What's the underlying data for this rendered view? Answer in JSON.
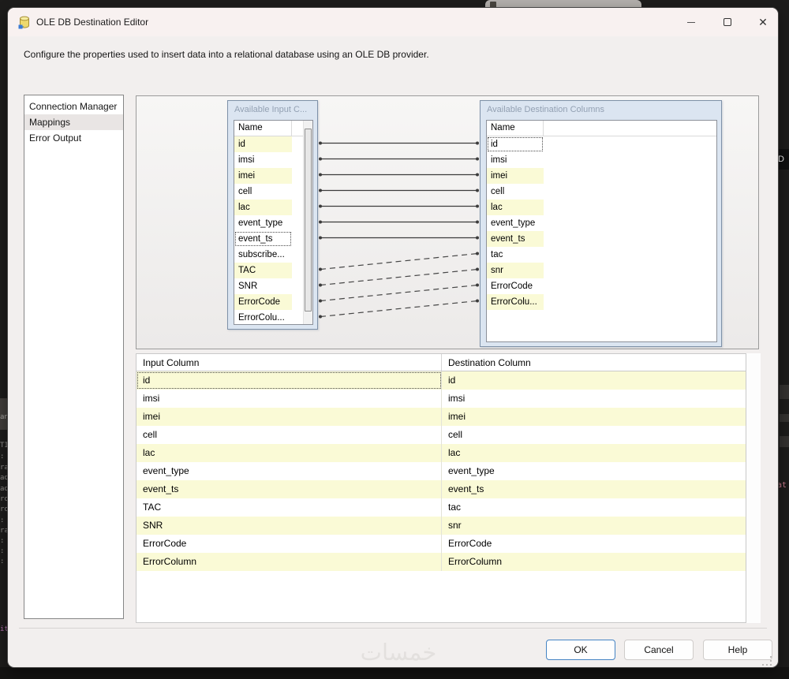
{
  "window": {
    "title": "OLE DB Destination Editor",
    "description": "Configure the properties used to insert data into a relational database using an OLE DB provider.",
    "controls": {
      "minimize": "minimize",
      "maximize": "maximize",
      "close": "close"
    }
  },
  "sidebar": {
    "items": [
      {
        "label": "Connection Manager",
        "selected": false
      },
      {
        "label": "Mappings",
        "selected": true
      },
      {
        "label": "Error Output",
        "selected": false
      }
    ]
  },
  "diagram": {
    "input_panel": {
      "title": "Available Input C...",
      "column_header": "Name",
      "rows": [
        "id",
        "imsi",
        "imei",
        "cell",
        "lac",
        "event_type",
        "event_ts",
        "subscribe...",
        "TAC",
        "SNR",
        "ErrorCode",
        "ErrorColu..."
      ],
      "focused_row": "event_ts"
    },
    "destination_panel": {
      "title": "Available Destination Columns",
      "column_header": "Name",
      "rows": [
        "id",
        "imsi",
        "imei",
        "cell",
        "lac",
        "event_type",
        "event_ts",
        "tac",
        "snr",
        "ErrorCode",
        "ErrorColu..."
      ],
      "focused_row": "id"
    },
    "connections": [
      {
        "from_index": 0,
        "to_index": 0,
        "style": "solid"
      },
      {
        "from_index": 1,
        "to_index": 1,
        "style": "solid"
      },
      {
        "from_index": 2,
        "to_index": 2,
        "style": "solid"
      },
      {
        "from_index": 3,
        "to_index": 3,
        "style": "solid"
      },
      {
        "from_index": 4,
        "to_index": 4,
        "style": "solid"
      },
      {
        "from_index": 5,
        "to_index": 5,
        "style": "solid"
      },
      {
        "from_index": 6,
        "to_index": 6,
        "style": "solid"
      },
      {
        "from_index": 8,
        "to_index": 7,
        "style": "dashed"
      },
      {
        "from_index": 9,
        "to_index": 8,
        "style": "dashed"
      },
      {
        "from_index": 10,
        "to_index": 9,
        "style": "dashed"
      },
      {
        "from_index": 11,
        "to_index": 10,
        "style": "dashed"
      }
    ]
  },
  "mapping_table": {
    "headers": [
      "Input Column",
      "Destination Column"
    ],
    "rows": [
      {
        "input": "id",
        "destination": "id"
      },
      {
        "input": "imsi",
        "destination": "imsi"
      },
      {
        "input": "imei",
        "destination": "imei"
      },
      {
        "input": "cell",
        "destination": "cell"
      },
      {
        "input": "lac",
        "destination": "lac"
      },
      {
        "input": "event_type",
        "destination": "event_type"
      },
      {
        "input": "event_ts",
        "destination": "event_ts"
      },
      {
        "input": "TAC",
        "destination": "tac"
      },
      {
        "input": "SNR",
        "destination": "snr"
      },
      {
        "input": "ErrorCode",
        "destination": "ErrorCode"
      },
      {
        "input": "ErrorColumn",
        "destination": "ErrorColumn"
      }
    ]
  },
  "footer": {
    "ok_label": "OK",
    "cancel_label": "Cancel",
    "help_label": "Help"
  },
  "watermark": "خمسات",
  "background": {
    "id_label": "ID",
    "at_fragment": "at",
    "left_fragments": [
      "an",
      "TI",
      ":",
      "ra",
      "ad",
      "ad",
      "ro",
      "ro",
      ":",
      "ra",
      ":",
      ":",
      ":",
      "it"
    ]
  },
  "colors": {
    "row_highlight": "#fafad6",
    "panel_header_bg": "#dbe5f1",
    "ok_border": "#4584c4",
    "dialog_bg": "#f2efee",
    "desktop_bg": "#1d1c1b"
  }
}
